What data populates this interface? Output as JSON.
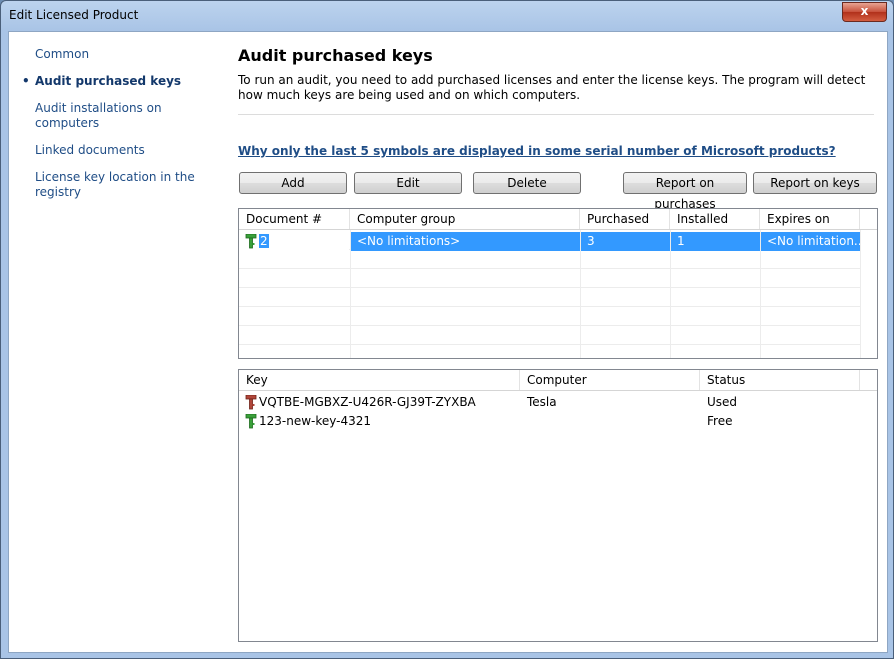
{
  "window": {
    "title": "Edit Licensed Product",
    "close_label": "x"
  },
  "nav": {
    "items": [
      {
        "label": "Common",
        "active": false
      },
      {
        "label": "Audit purchased keys",
        "active": true
      },
      {
        "label": "Audit installations on computers",
        "active": false
      },
      {
        "label": "Linked documents",
        "active": false
      },
      {
        "label": "License key location in the registry",
        "active": false
      }
    ]
  },
  "main": {
    "title": "Audit purchased keys",
    "description": "To run an audit, you need to add purchased licenses and enter the license keys. The program will detect how much keys are being used and on which computers.",
    "help_link": "Why only the last 5 symbols are displayed in some serial number of Microsoft products?"
  },
  "toolbar": {
    "add": "Add",
    "edit": "Edit",
    "delete": "Delete",
    "report_purchases": "Report on purchases",
    "report_keys": "Report on keys"
  },
  "documents_table": {
    "columns": [
      "Document #",
      "Computer group",
      "Purchased",
      "Installed",
      "Expires on"
    ],
    "rows": [
      {
        "document": "2",
        "group": "<No limitations>",
        "purchased": "3",
        "installed": "1",
        "expires": "<No limitation..."
      }
    ]
  },
  "keys_table": {
    "columns": [
      "Key",
      "Computer",
      "Status"
    ],
    "rows": [
      {
        "key": "VQTBE-MGBXZ-U426R-GJ39T-ZYXBA",
        "computer": "Tesla",
        "status": "Used",
        "icon": "key-used-icon",
        "icon_color": "#b0463a"
      },
      {
        "key": "123-new-key-4321",
        "computer": "",
        "status": "Free",
        "icon": "key-free-icon",
        "icon_color": "#3aa03a"
      }
    ]
  }
}
